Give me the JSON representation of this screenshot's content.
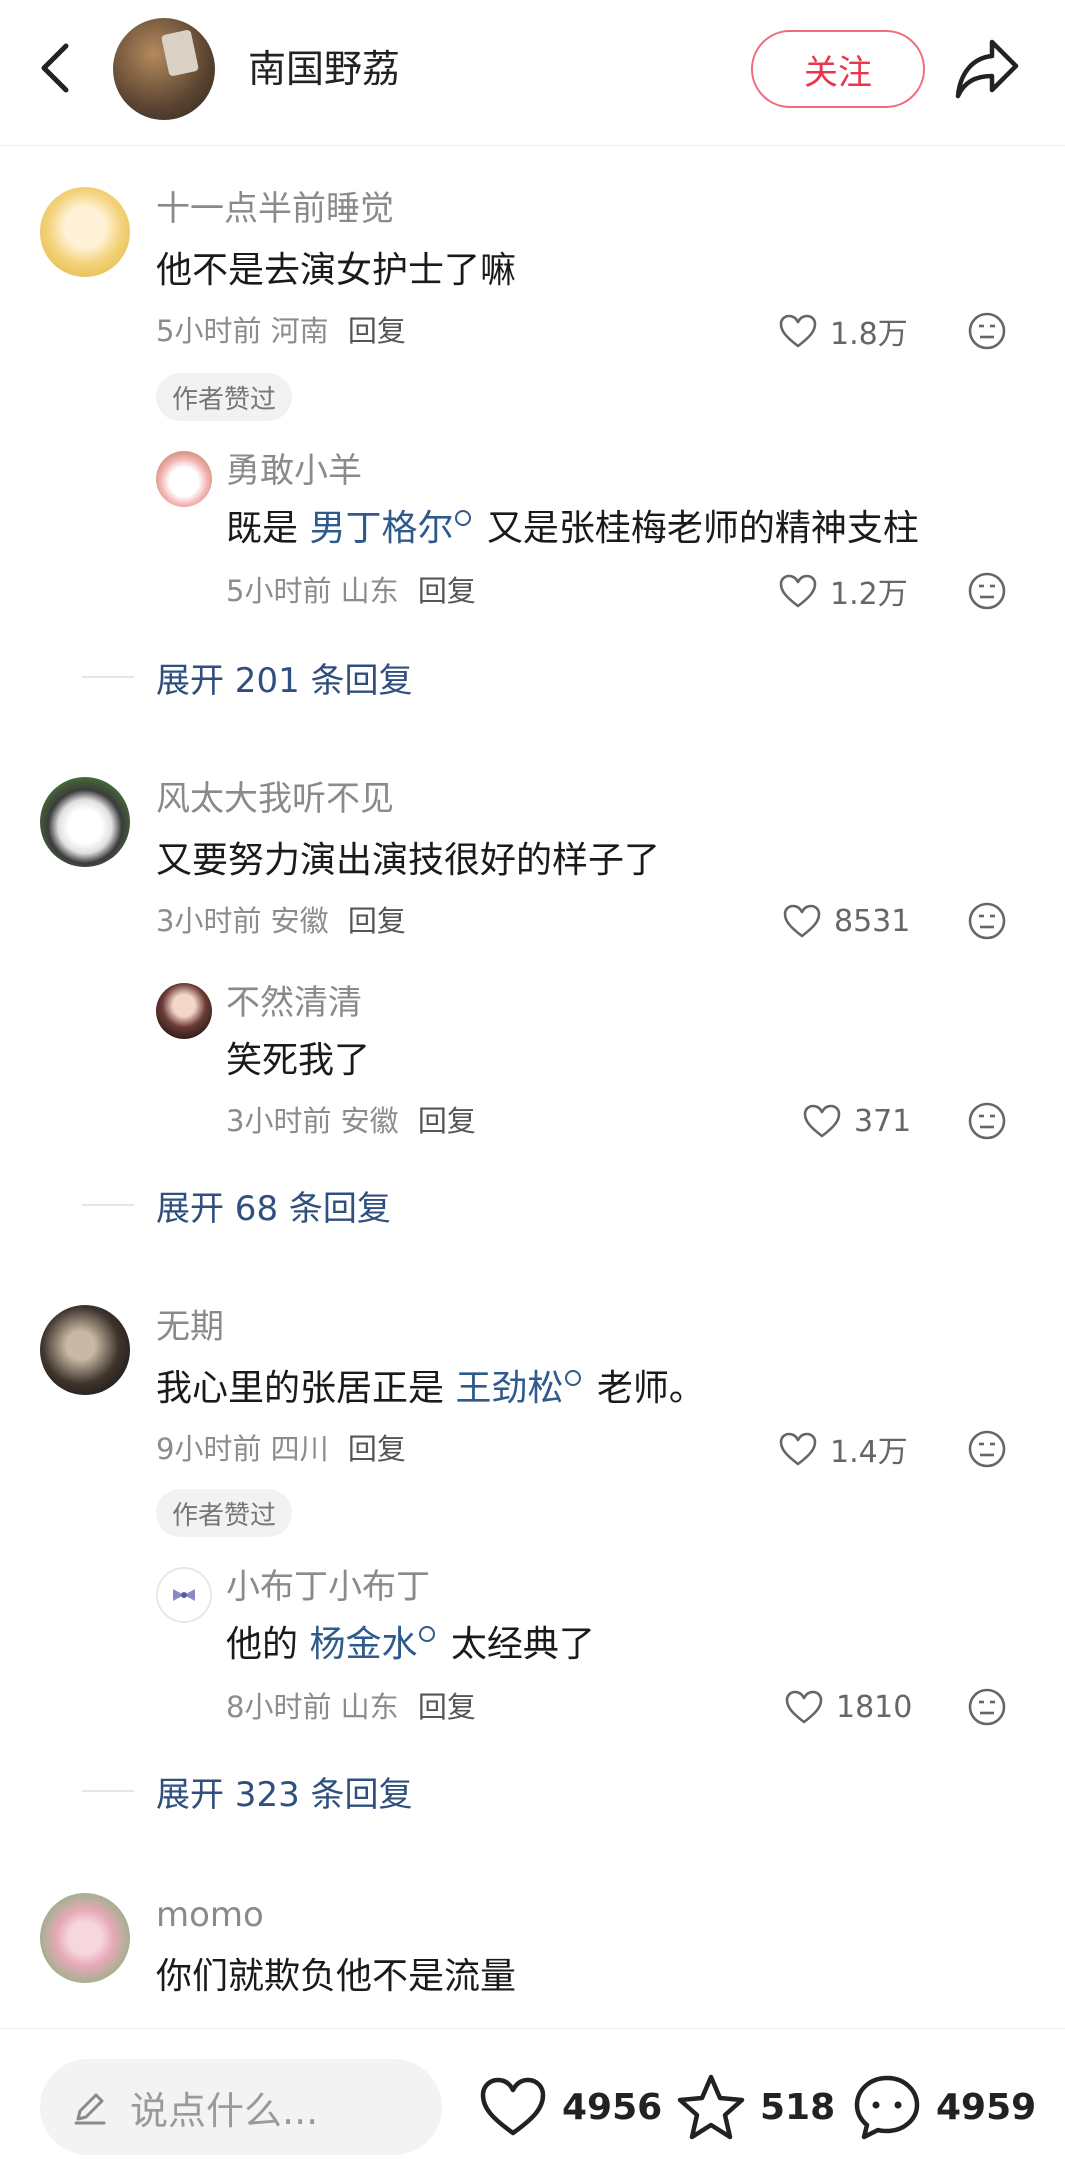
{
  "header": {
    "title": "南国野荔",
    "follow_label": "关注",
    "icons": [
      "chevron-left-icon",
      "share-icon"
    ]
  },
  "badge_text": "作者赞过",
  "reply_label": "回复",
  "comments": [
    {
      "name": "十一点半前睡觉",
      "content": "他不是去演女护士了嘛",
      "time": "5小时前",
      "region": "河南",
      "likes": "1.8万",
      "author_liked": true,
      "sub": {
        "name": "勇敢小羊",
        "pre": "既是 ",
        "link": "男丁格尔",
        "post": " 又是张桂梅老师的精神支柱",
        "time": "5小时前",
        "region": "山东",
        "likes": "1.2万"
      },
      "expand": "展开 201 条回复"
    },
    {
      "name": "风太大我听不见",
      "content": "又要努力演出演技很好的样子了",
      "time": "3小时前",
      "region": "安徽",
      "likes": "8531",
      "author_liked": false,
      "sub": {
        "name": "不然清清",
        "pre": "笑死我了",
        "link": "",
        "post": "",
        "time": "3小时前",
        "region": "安徽",
        "likes": "371"
      },
      "expand": "展开 68 条回复"
    },
    {
      "name": "无期",
      "pre": "我心里的张居正是 ",
      "link": "王劲松",
      "post": " 老师。",
      "time": "9小时前",
      "region": "四川",
      "likes": "1.4万",
      "author_liked": true,
      "sub": {
        "name": "小布丁小布丁",
        "pre": "他的 ",
        "link": "杨金水",
        "post": " 太经典了",
        "time": "8小时前",
        "region": "山东",
        "likes": "1810"
      },
      "expand": "展开 323 条回复"
    },
    {
      "name": "momo",
      "content": "你们就欺负他不是流量"
    }
  ],
  "bottom_bar": {
    "input_placeholder": "说点什么...",
    "likes": "4956",
    "favorites": "518",
    "comments": "4959"
  },
  "colors": {
    "accent": "#e8374d",
    "link": "#2f5a8c",
    "expand": "#2f4f7f",
    "meta": "#8c8c8c"
  }
}
